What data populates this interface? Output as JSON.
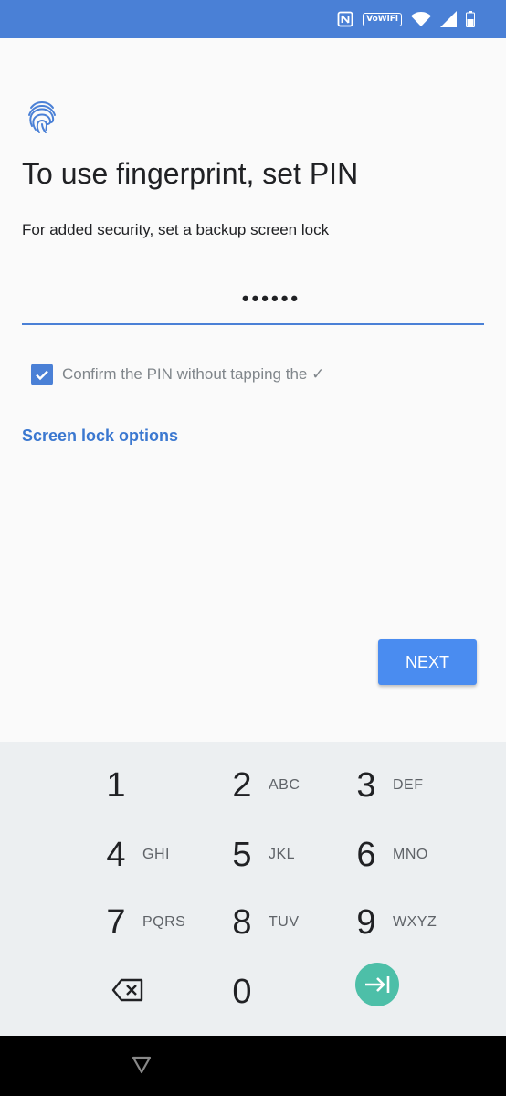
{
  "status_bar": {
    "vowifi": "VoWiFi"
  },
  "screen": {
    "title": "To use fingerprint, set PIN",
    "subtitle": "For added security, set a backup screen lock",
    "pin_value": "••••••",
    "confirm_label": "Confirm the PIN without tapping the ✓",
    "confirm_checked": true,
    "lock_options": "Screen lock options",
    "next_label": "NEXT"
  },
  "keypad": {
    "keys": [
      {
        "digit": "1",
        "letters": ""
      },
      {
        "digit": "2",
        "letters": "ABC"
      },
      {
        "digit": "3",
        "letters": "DEF"
      },
      {
        "digit": "4",
        "letters": "GHI"
      },
      {
        "digit": "5",
        "letters": "JKL"
      },
      {
        "digit": "6",
        "letters": "MNO"
      },
      {
        "digit": "7",
        "letters": "PQRS"
      },
      {
        "digit": "8",
        "letters": "TUV"
      },
      {
        "digit": "9",
        "letters": "WXYZ"
      },
      {
        "digit": "0",
        "letters": ""
      }
    ]
  },
  "colors": {
    "accent": "#4a80d6",
    "next_button": "#4a8cf0",
    "go_button": "#4dbfa8",
    "keypad_bg": "#eceff1"
  },
  "icons": {
    "status": [
      "nfc-icon",
      "vowifi-badge",
      "wifi-icon",
      "cell-signal-icon",
      "battery-icon"
    ],
    "header": "fingerprint-icon",
    "keypad": [
      "backspace-icon",
      "enter-arrow-icon"
    ],
    "nav": "back-triangle-icon"
  }
}
